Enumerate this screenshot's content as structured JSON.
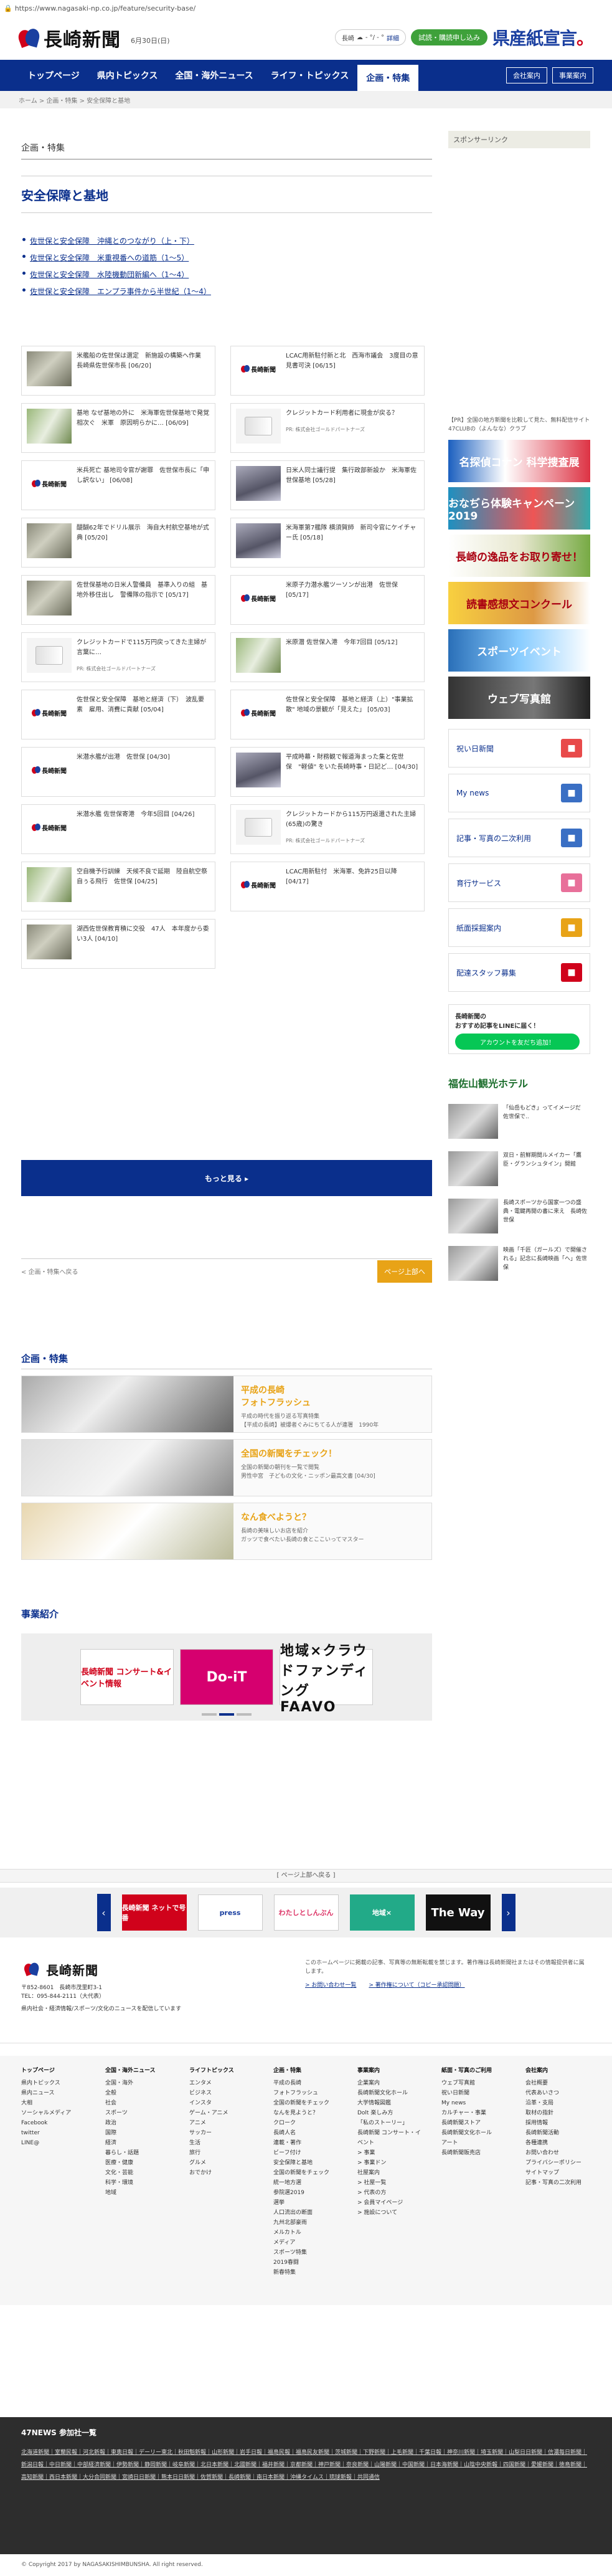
{
  "url": "https://www.nagasaki-np.co.jp/feature/security-base/",
  "header": {
    "logo_text": "長崎新聞",
    "date": "6月30日(日)",
    "weather_label": "長崎",
    "weather_temp": "- °/ - °",
    "weather_link": "詳細",
    "login_button": "試読・購読申し込み",
    "kenzan_ad": "県産紙宣言",
    "kenzan_dot": "。"
  },
  "nav": {
    "items": [
      "トップページ",
      "県内トピックス",
      "全国・海外ニュース",
      "ライフ・トピックス",
      "企画・特集"
    ],
    "company_button": "会社案内",
    "business_button": "事業案内"
  },
  "breadcrumb": "ホーム > 企画・特集 > 安全保障と基地",
  "main": {
    "section_label": "企画・特集",
    "title": "安全保障と基地",
    "links": [
      "佐世保と安全保障　沖縄とのつながり（上・下）",
      "佐世保と安全保障　米重視番への道筋（1〜5）",
      "佐世保と安全保障　水陸機動団新編へ（1〜4）",
      "佐世保と安全保障　エンプラ事件から半世紀（1〜4）"
    ],
    "cards": [
      {
        "text": "米艦船の佐世保は選定　新施設の構築へ作業　長崎県佐世保市長 [06/20]",
        "thumb": "photo"
      },
      {
        "text": "LCAC用新駐付新と北　西海市議会　3度目の意見書可決 [06/15]",
        "thumb": "logo"
      },
      {
        "text": "基地 なぜ基地の外に　米海軍佐世保基地で発覚相次ぐ　米軍　原因明らかに… [06/09]",
        "thumb": "photo3"
      },
      {
        "text": "クレジットカード利用者に現金が戻る？",
        "pr": "PR: 株式会社ゴールドパートナーズ",
        "thumb": "card-img"
      },
      {
        "text": "米兵死亡 基地司令官が謝罪　佐世保市長に「申し訳ない」 [06/08]",
        "thumb": "logo"
      },
      {
        "text": "日米人同士議行提　集行政部新設か　米海軍佐世保基地 [05/28]",
        "thumb": "photo2"
      },
      {
        "text": "醍醐62年でドリル展示　海自大村航空基地が式典 [05/20]",
        "thumb": "photo"
      },
      {
        "text": "米海軍第7艦隊 横須賀師　新司令官にケイチャー氏 [05/18]",
        "thumb": "photo2"
      },
      {
        "text": "佐世保基地の日米人警備員　基準入りの組　基地外移住出し　警備隊の指示で [05/17]",
        "thumb": "photo"
      },
      {
        "text": "米原子力潜水艦ツーソンが出港　佐世保 [05/17]",
        "thumb": "logo"
      },
      {
        "text": "クレジットカードで115万円戻ってきた主婦が言葉に…",
        "pr": "PR: 株式会社ゴールドパートナーズ",
        "thumb": "card-img"
      },
      {
        "text": "米原潜 佐世保入港　今年7回目 [05/12]",
        "thumb": "photo3"
      },
      {
        "text": "佐世保と安全保障　基地と経済（下）　波乱要素　雇用、消費に貢献 [05/04]",
        "thumb": "logo"
      },
      {
        "text": "佐世保と安全保障　基地と経済（上）\"事業拡散\" 地域の景観が「見えた」 [05/03]",
        "thumb": "logo"
      },
      {
        "text": "米潜水艦が出港　佐世保 [04/30]",
        "thumb": "logo"
      },
      {
        "text": "平成時幕・財務観で報道海まった集と佐世保　\"軽値\" をいた長崎時事・日記ど… [04/30]",
        "thumb": "photo2"
      },
      {
        "text": "米潜水艦 佐世保寄港　今年5回目 [04/26]",
        "thumb": "logo"
      },
      {
        "text": "クレジットカードから115万円返還された主婦(65歳)の驚き",
        "pr": "PR: 株式会社ゴールドパートナーズ",
        "thumb": "card-img"
      },
      {
        "text": "空自機予行訓練　天候不良で延期　陸自航空祭　自ぅる飛行　佐世保 [04/25]",
        "thumb": "photo3"
      },
      {
        "text": "LCAC用新駐付　米海軍、免許25日以降 [04/17]",
        "thumb": "logo"
      },
      {
        "text": "湖西佐世保教育積に交役　47人　本年度から委い3人 [04/10]",
        "thumb": "photo"
      }
    ],
    "more_button": "もっと見る ▸",
    "back_link": "< 企画・特集へ戻る",
    "page_top": "ページ上部へ"
  },
  "feature": {
    "heading": "企画・特集",
    "items": [
      {
        "title": "平成の長崎\nフォトフラッシュ",
        "desc": "平成の時代を振り返る写真特集",
        "caption": "【平成の長崎】被爆者ぐみにちてる人が連署　1990年"
      },
      {
        "title": "全国の新聞をチェック！",
        "desc": "全国の新聞の朝刊を一覧で閲覧",
        "caption": "男性中宮　子どもの文化・ニッポン最高文書 [04/30]"
      },
      {
        "title": "なん食べようと？",
        "desc": "長崎の美味しいお店を紹介",
        "caption": "ガッツで食べたい長崎の食とここいってマスター"
      }
    ]
  },
  "business": {
    "heading": "事業紹介",
    "banners": [
      "長崎新聞 コンサート&イベント情報",
      "Do-iT",
      "地域×クラウドファンディング FAAVO"
    ]
  },
  "sidebar": {
    "sponsor": "スポンサーリンク",
    "ad_text": "【PR】全国の地方新聞を比較して見た、無料配信サイト 47CLUBの（よんなな）クラブ",
    "ads": [
      "名探偵コナン 科学捜査展",
      "おなぢら体験キャンペーン 2019",
      "長崎の逸品をお取り寄せ！",
      "読書感想文コンクール",
      "スポーツイベント",
      "ウェブ写真館"
    ],
    "buttons": [
      {
        "label": "祝い日新聞",
        "color": "#e84a4a"
      },
      {
        "label": "My news",
        "color": "#3a6fc4"
      },
      {
        "label": "記事・写真の二次利用",
        "color": "#3a6fc4"
      },
      {
        "label": "育行サービス",
        "color": "#e8709a"
      },
      {
        "label": "紙面採掘案内",
        "color": "#e8a317"
      },
      {
        "label": "配達スタッフ募集",
        "color": "#d0021b"
      }
    ],
    "line_title": "長崎新聞の\nおすすめ記事をLINEに届く！",
    "line_button": "アカウントを友だち追加！",
    "hotel": "福佐山観光ホテル",
    "news": [
      "「仙岳もどき」ってイメージだ　佐世保で..",
      "双日・前鮮期間ルメイカー「鷹臣・グランシュタイン」開館",
      "長崎スポーツから国家一つの盛典・電鍵再開の書に来え　長崎佐世保",
      "映画「千匠（ガールズ）で開催される」記念に長崎映画「へ」佐世保"
    ]
  },
  "footer": {
    "top_link": "[ ページ上部へ戻る ]",
    "banners": [
      "長崎新聞 ネットで号番",
      "press",
      "わたしとしんぶん",
      "地域×",
      "The Way"
    ],
    "logo_text": "長崎新聞",
    "tagline": "県内社会・経済情報/スポーツ/文化のニュースを配信しています",
    "address": "〒852-8601　長崎市茂里町3-1\nTEL：095-844-2111（大代表）",
    "note": "このホームページに掲載の記事、写真等の無断転載を禁じます。著作権は長崎新聞社またはその情報提供者に属します。",
    "note_links": [
      "> お問い合わせ一覧",
      "> 著作権について（コピー承認問題）"
    ],
    "columns": [
      {
        "h": "トップページ",
        "items": [
          "県内トピックス",
          "県内ニュース",
          "大相",
          "ソーシャルメディア",
          "Facebook",
          "twitter",
          "LINE@"
        ]
      },
      {
        "h": "全国・海外ニュース",
        "items": [
          "全国・海外",
          "全般",
          "社会",
          "スポーツ",
          "政治",
          "国際",
          "経済",
          "暮らし・話題",
          "医療・健康",
          "文化・芸能",
          "科学・環境",
          "地域"
        ]
      },
      {
        "h": "ライフトピックス",
        "items": [
          "エンタメ",
          "ビジネス",
          "インスタ",
          "ゲーム・アニメ",
          "アニメ",
          "サッカー",
          "生活",
          "旅行",
          "グルメ",
          "おでかけ"
        ]
      },
      {
        "h": "企画・特集",
        "items": [
          "平成の長崎",
          "フォトフラッシュ",
          "全国の新聞をチェック",
          "なんを見ようと？",
          "クローク",
          "長崎人名",
          "連載・著作",
          "ビーフ付け",
          "安全保障と基地",
          "全国の新聞をチェック",
          "統一地方選",
          "参院選2019",
          "選挙",
          "人口流出の断面",
          "九州北部豪雨",
          "メルカトル",
          "メディア",
          "スポーツ特集",
          "2019春闘",
          "新春特集"
        ]
      },
      {
        "h": "事業案内",
        "items": [
          "企業案内",
          "長崎新聞文化ホール",
          "大学情報図鑑",
          "Dolt 楽しみ方",
          "「私のストーリー」",
          "長崎新聞 コンサート・イベント",
          "> 事業",
          "> 事業ドン",
          "社屋案内",
          "> 社屋一覧",
          "> 代表の方",
          "> 会員マイページ",
          "> 施設について"
        ]
      },
      {
        "h": "紙面・写真のご利用",
        "items": [
          "ウェブ写真館",
          "祝い日新聞",
          "My news",
          "カルチャー・事業",
          "長崎新聞ストア",
          "長崎新聞文化ホール",
          "アート",
          "長崎新聞販売店"
        ]
      },
      {
        "h": "会社案内",
        "items": [
          "会社概要",
          "代表あいさつ",
          "沿革・支局",
          "取材の指針",
          "採用情報",
          "長崎新聞活動",
          "各種連携",
          "お問い合わせ",
          "プライバシーポリシー",
          "サイトマップ",
          "記事・写真の二次利用"
        ]
      }
    ],
    "news47_heading": "47NEWS 参加社一覧",
    "news47_list": "北海道新聞｜室蘭民報｜河北新報｜東奥日報｜デーリー東北｜秋田魁新報｜山形新聞｜岩手日報｜福島民報｜福島民友新聞｜茨城新聞｜下野新聞｜上毛新聞｜千葉日報｜神奈川新聞｜埼玉新聞｜山梨日日新聞｜信濃毎日新聞｜新潟日報｜中日新聞｜中部経済新聞｜伊勢新聞｜静岡新聞｜岐阜新聞｜北日本新聞｜北國新聞｜福井新聞｜京都新聞｜神戸新聞｜奈良新聞｜山陽新聞｜中国新聞｜日本海新聞｜山陰中央新報｜四国新聞｜愛媛新聞｜徳島新聞｜高知新聞｜西日本新聞｜大分合同新聞｜宮崎日日新聞｜熊本日日新聞｜佐賀新聞｜長崎新聞｜南日本新聞｜沖縄タイムス｜琉球新報｜共同通信",
    "copyright": "© Copyright 2017 by NAGASAKISHIMBUNSHA. All right reserved."
  }
}
